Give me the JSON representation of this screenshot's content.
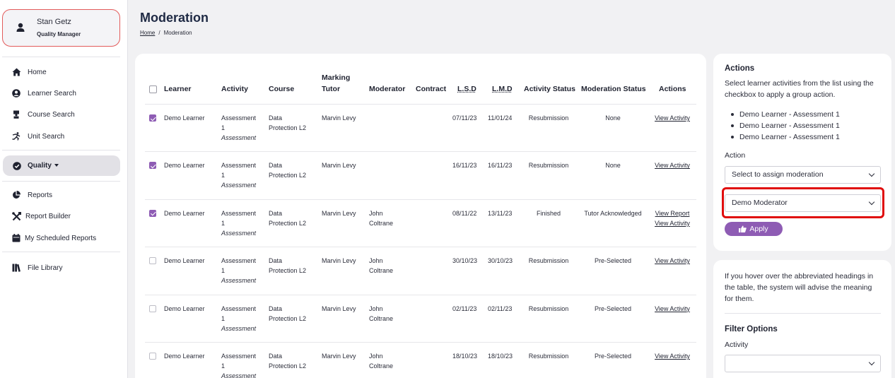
{
  "user": {
    "name": "Stan Getz",
    "role": "Quality Manager"
  },
  "nav": {
    "home": "Home",
    "learner_search": "Learner Search",
    "course_search": "Course Search",
    "unit_search": "Unit Search",
    "quality": "Quality",
    "reports": "Reports",
    "report_builder": "Report Builder",
    "scheduled_reports": "My Scheduled Reports",
    "file_library": "File Library"
  },
  "page": {
    "title": "Moderation",
    "breadcrumb_home": "Home",
    "breadcrumb_current": "Moderation"
  },
  "table": {
    "headers": {
      "learner": "Learner",
      "activity": "Activity",
      "course": "Course",
      "marking_tutor_1": "Marking",
      "marking_tutor_2": "Tutor",
      "moderator": "Moderator",
      "contract": "Contract",
      "lsd": "L.S.D",
      "lmd": "L.M.D",
      "activity_status": "Activity Status",
      "moderation_status": "Moderation Status",
      "actions": "Actions"
    },
    "rows": [
      {
        "checked": true,
        "learner": "Demo Learner",
        "activity_1": "Assessment",
        "activity_2": "1",
        "activity_type": "Assessment",
        "course_1": "Data",
        "course_2": "Protection L2",
        "tutor": "Marvin Levy",
        "moderator_1": "",
        "moderator_2": "",
        "contract": "",
        "lsd": "07/11/23",
        "lmd": "11/01/24",
        "activity_status": "Resubmission",
        "moderation_status": "None",
        "action_1": "View Activity",
        "action_2": ""
      },
      {
        "checked": true,
        "learner": "Demo Learner",
        "activity_1": "Assessment",
        "activity_2": "1",
        "activity_type": "Assessment",
        "course_1": "Data",
        "course_2": "Protection L2",
        "tutor": "Marvin Levy",
        "moderator_1": "",
        "moderator_2": "",
        "contract": "",
        "lsd": "16/11/23",
        "lmd": "16/11/23",
        "activity_status": "Resubmission",
        "moderation_status": "None",
        "action_1": "View Activity",
        "action_2": ""
      },
      {
        "checked": true,
        "learner": "Demo Learner",
        "activity_1": "Assessment",
        "activity_2": "1",
        "activity_type": "Assessment",
        "course_1": "Data",
        "course_2": "Protection L2",
        "tutor": "Marvin Levy",
        "moderator_1": "John",
        "moderator_2": "Coltrane",
        "contract": "",
        "lsd": "08/11/22",
        "lmd": "13/11/23",
        "activity_status": "Finished",
        "moderation_status": "Tutor Acknowledged",
        "action_1": "View Report",
        "action_2": "View Activity"
      },
      {
        "checked": false,
        "learner": "Demo Learner",
        "activity_1": "Assessment",
        "activity_2": "1",
        "activity_type": "Assessment",
        "course_1": "Data",
        "course_2": "Protection L2",
        "tutor": "Marvin Levy",
        "moderator_1": "John",
        "moderator_2": "Coltrane",
        "contract": "",
        "lsd": "30/10/23",
        "lmd": "30/10/23",
        "activity_status": "Resubmission",
        "moderation_status": "Pre-Selected",
        "action_1": "View Activity",
        "action_2": ""
      },
      {
        "checked": false,
        "learner": "Demo Learner",
        "activity_1": "Assessment",
        "activity_2": "1",
        "activity_type": "Assessment",
        "course_1": "Data",
        "course_2": "Protection L2",
        "tutor": "Marvin Levy",
        "moderator_1": "John",
        "moderator_2": "Coltrane",
        "contract": "",
        "lsd": "02/11/23",
        "lmd": "02/11/23",
        "activity_status": "Resubmission",
        "moderation_status": "Pre-Selected",
        "action_1": "View Activity",
        "action_2": ""
      },
      {
        "checked": false,
        "learner": "Demo Learner",
        "activity_1": "Assessment",
        "activity_2": "1",
        "activity_type": "Assessment",
        "course_1": "Data",
        "course_2": "Protection L2",
        "tutor": "Marvin Levy",
        "moderator_1": "John",
        "moderator_2": "Coltrane",
        "contract": "",
        "lsd": "18/10/23",
        "lmd": "18/10/23",
        "activity_status": "Resubmission",
        "moderation_status": "Pre-Selected",
        "action_1": "View Activity",
        "action_2": ""
      }
    ]
  },
  "actions_panel": {
    "title": "Actions",
    "description": "Select learner activities from the list using the checkbox to apply a group action.",
    "selected": [
      "Demo Learner - Assessment 1",
      "Demo Learner - Assessment 1",
      "Demo Learner - Assessment 1"
    ],
    "action_label": "Action",
    "action_select": "Select to assign moderation",
    "moderator_select": "Demo Moderator",
    "apply_label": "Apply"
  },
  "info_panel": {
    "hint": "If you hover over the abbreviated headings in the table, the system will advise the meaning for them.",
    "filter_title": "Filter Options",
    "activity_label": "Activity",
    "activity_select": ""
  },
  "colors": {
    "accent": "#8e5cb4",
    "highlight": "#e00d0d",
    "user_card_border": "#e35b5b"
  }
}
